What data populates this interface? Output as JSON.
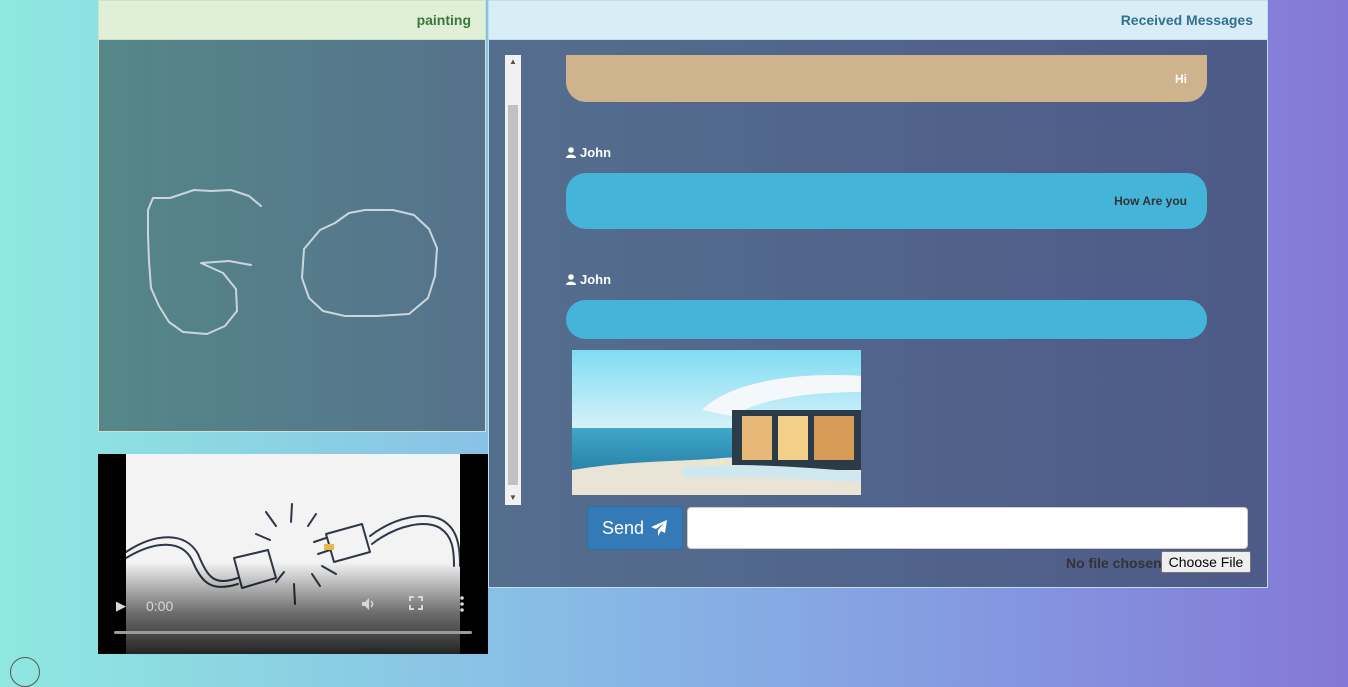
{
  "painting": {
    "title": "painting"
  },
  "video": {
    "time": "0:00",
    "progress": 0
  },
  "messages": {
    "title": "Received Messages",
    "items": [
      {
        "sender": "",
        "text": "Hi"
      },
      {
        "sender": "John",
        "text": "How Are you"
      },
      {
        "sender": "John",
        "text": ""
      }
    ]
  },
  "composer": {
    "send_label": "Send",
    "input_value": "",
    "file_status": "No file chosen",
    "file_button": "Choose File"
  },
  "colors": {
    "painting_header": "#e0f0d8",
    "messages_header": "#d9edf7",
    "bubble_tan": "#cfb38c",
    "bubble_blue": "#44b5d9",
    "send_button": "#337ab7"
  }
}
